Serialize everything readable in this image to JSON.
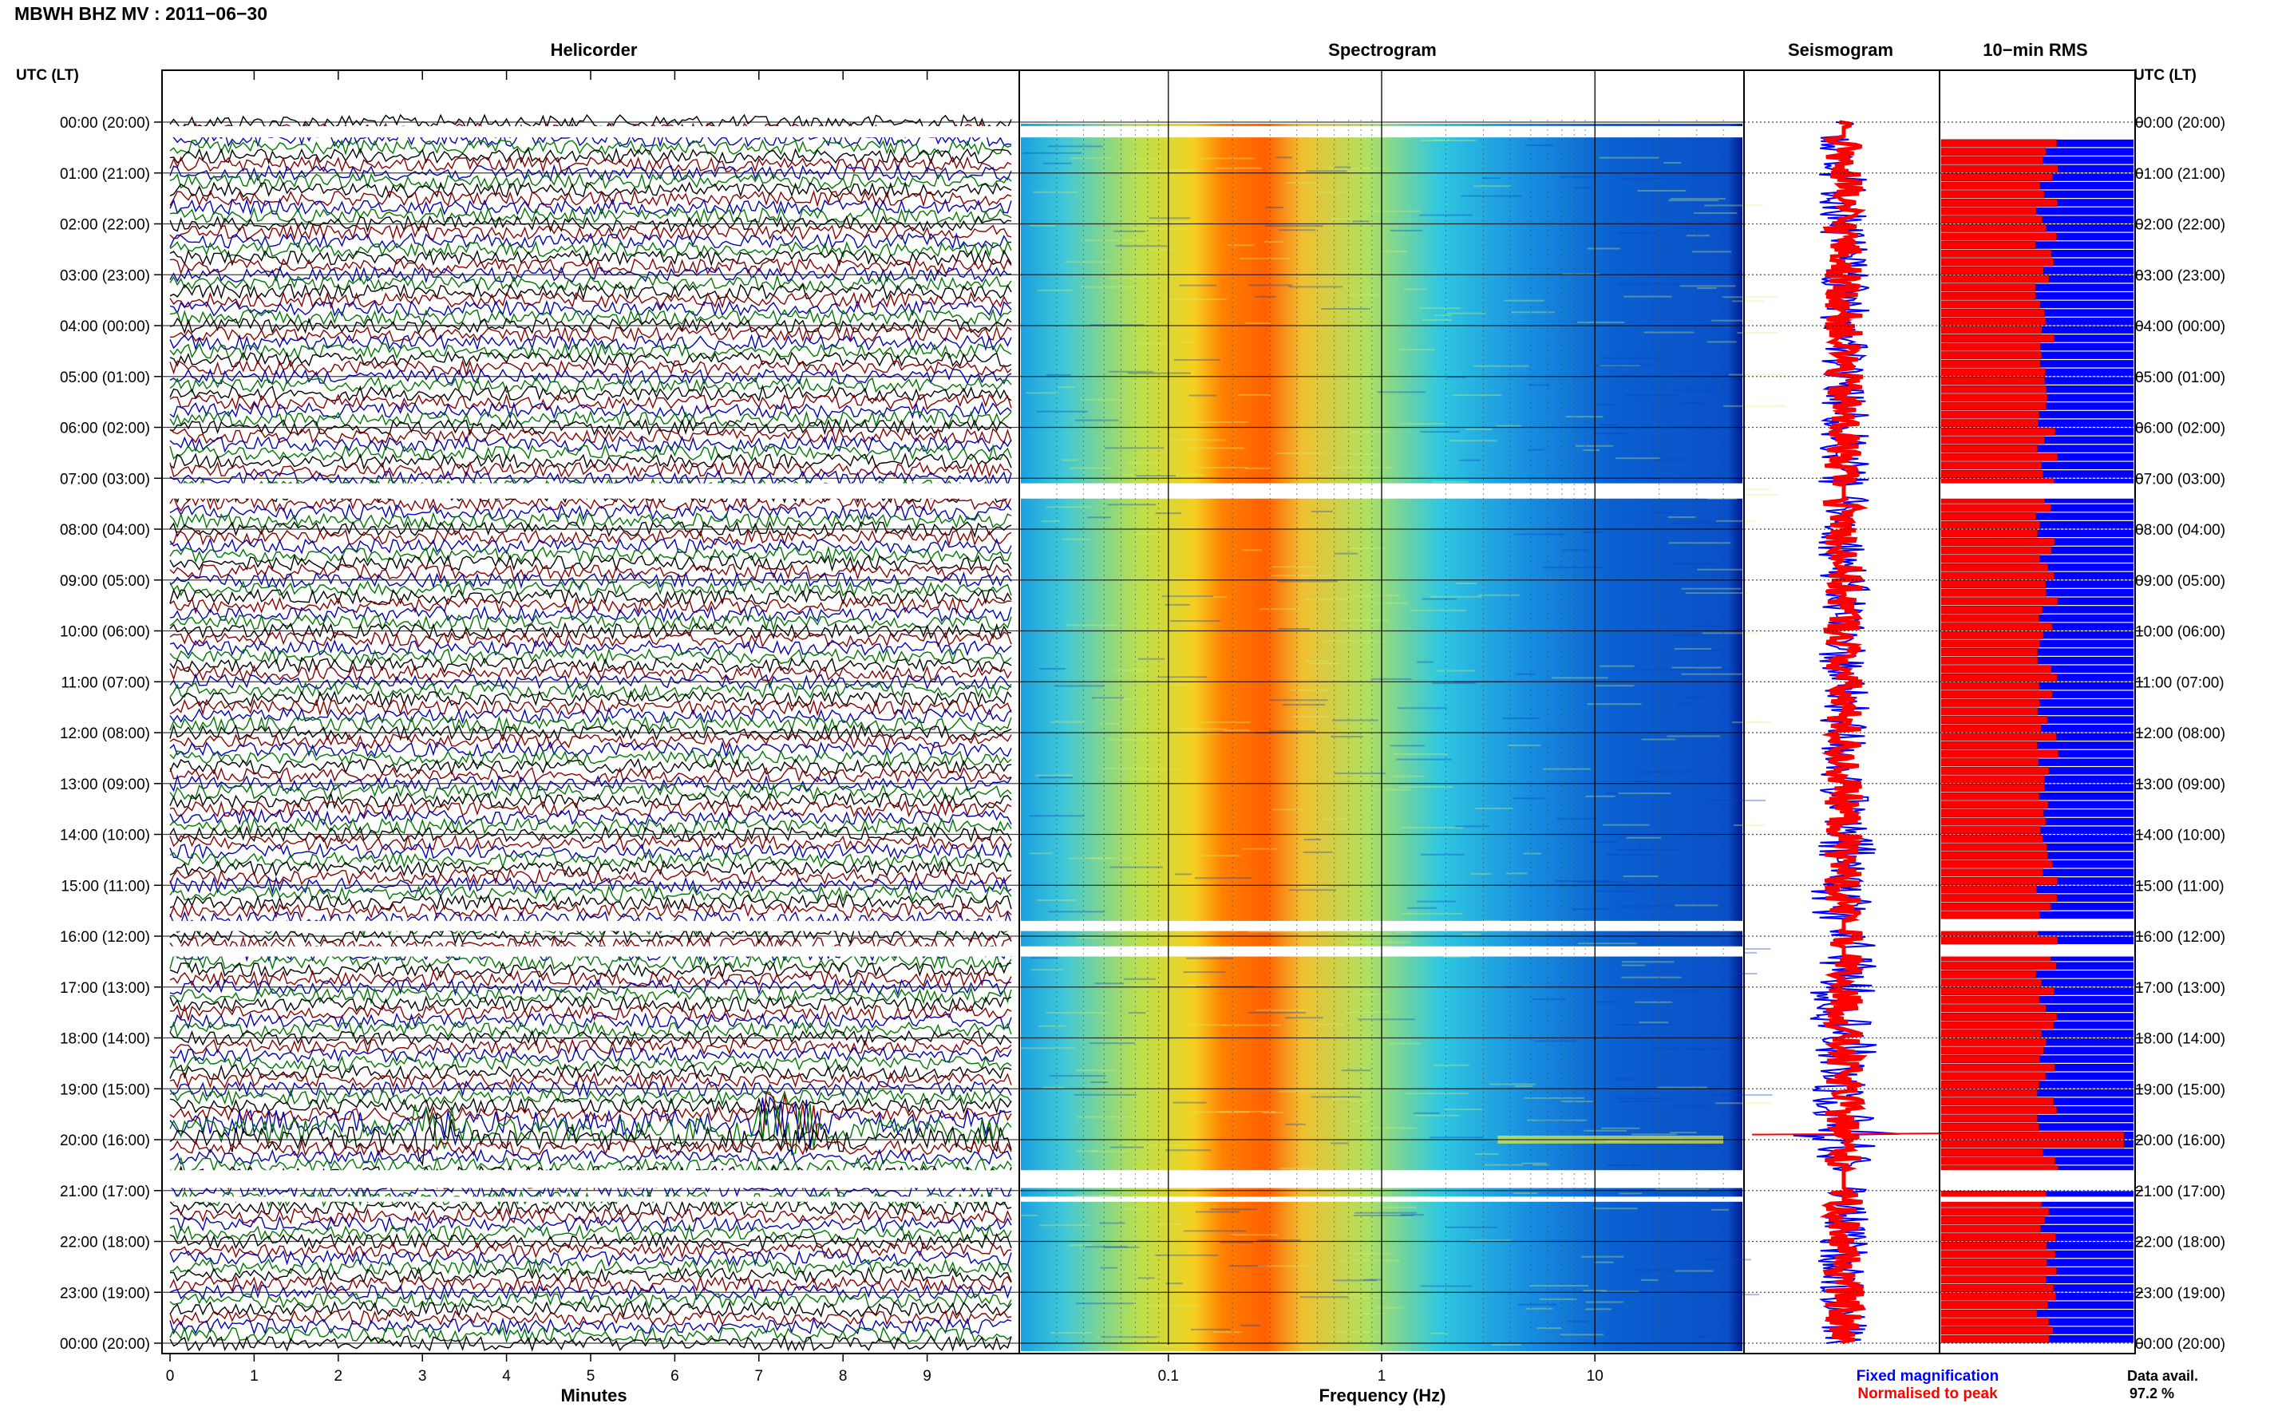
{
  "title": "MBWH BHZ MV : 2011−06−30",
  "time_axis_label": "UTC (LT)",
  "panels": {
    "helicorder": "Helicorder",
    "spectrogram": "Spectrogram",
    "seismogram": "Seismogram",
    "rms": "10−min RMS"
  },
  "xlabels": {
    "helicorder": "Minutes",
    "spectrogram": "Frequency (Hz)"
  },
  "legend": {
    "fixed": "Fixed magnification",
    "normalised": "Normalised to peak"
  },
  "data_avail": {
    "label": "Data avail.",
    "value": "97.2 %"
  },
  "colors": {
    "fixed": "#0000ff",
    "normalised": "#ff0000",
    "trace_cycle": [
      "#000000",
      "#8b0000",
      "#0000b4",
      "#007800"
    ]
  },
  "chart_data": {
    "type": "seismic-summary",
    "time_ticks": [
      "00:00 (20:00)",
      "01:00 (21:00)",
      "02:00 (22:00)",
      "03:00 (23:00)",
      "04:00 (00:00)",
      "05:00 (01:00)",
      "06:00 (02:00)",
      "07:00 (03:00)",
      "08:00 (04:00)",
      "09:00 (05:00)",
      "10:00 (06:00)",
      "11:00 (07:00)",
      "12:00 (08:00)",
      "13:00 (09:00)",
      "14:00 (10:00)",
      "15:00 (11:00)",
      "16:00 (12:00)",
      "17:00 (13:00)",
      "18:00 (14:00)",
      "19:00 (15:00)",
      "20:00 (16:00)",
      "21:00 (17:00)",
      "22:00 (18:00)",
      "23:00 (19:00)",
      "00:00 (20:00)"
    ],
    "helicorder": {
      "minutes_ticks": [
        "0",
        "1",
        "2",
        "3",
        "4",
        "5",
        "6",
        "7",
        "8",
        "9"
      ],
      "xlim": [
        0,
        10
      ],
      "lines_per_hour": 6
    },
    "spectrogram": {
      "xscale": "log",
      "xlim": [
        0.02,
        50
      ],
      "tick_labels": [
        "0.1",
        "1",
        "10"
      ],
      "tick_values": [
        0.1,
        1,
        10
      ]
    },
    "data_gaps_utc_hours": [
      [
        0.08,
        0.3
      ],
      [
        7.1,
        7.4
      ],
      [
        15.7,
        15.9
      ],
      [
        16.2,
        16.4
      ],
      [
        20.6,
        20.95
      ],
      [
        21.12,
        21.22
      ]
    ],
    "events": [
      {
        "time_utc_hours": 19.85,
        "panel": "helicorder",
        "minute_start": 2.9,
        "minute_end": 3.4
      },
      {
        "time_utc_hours": 19.7,
        "panel": "helicorder",
        "minute_start": 7.0,
        "minute_end": 7.7
      }
    ],
    "rms": {
      "xlim": [
        0,
        1
      ],
      "normalised_typical": 0.55,
      "fixed_typical": 1.0,
      "peak_utc_hours": 19.9
    },
    "data_availability_percent": 97.2
  }
}
